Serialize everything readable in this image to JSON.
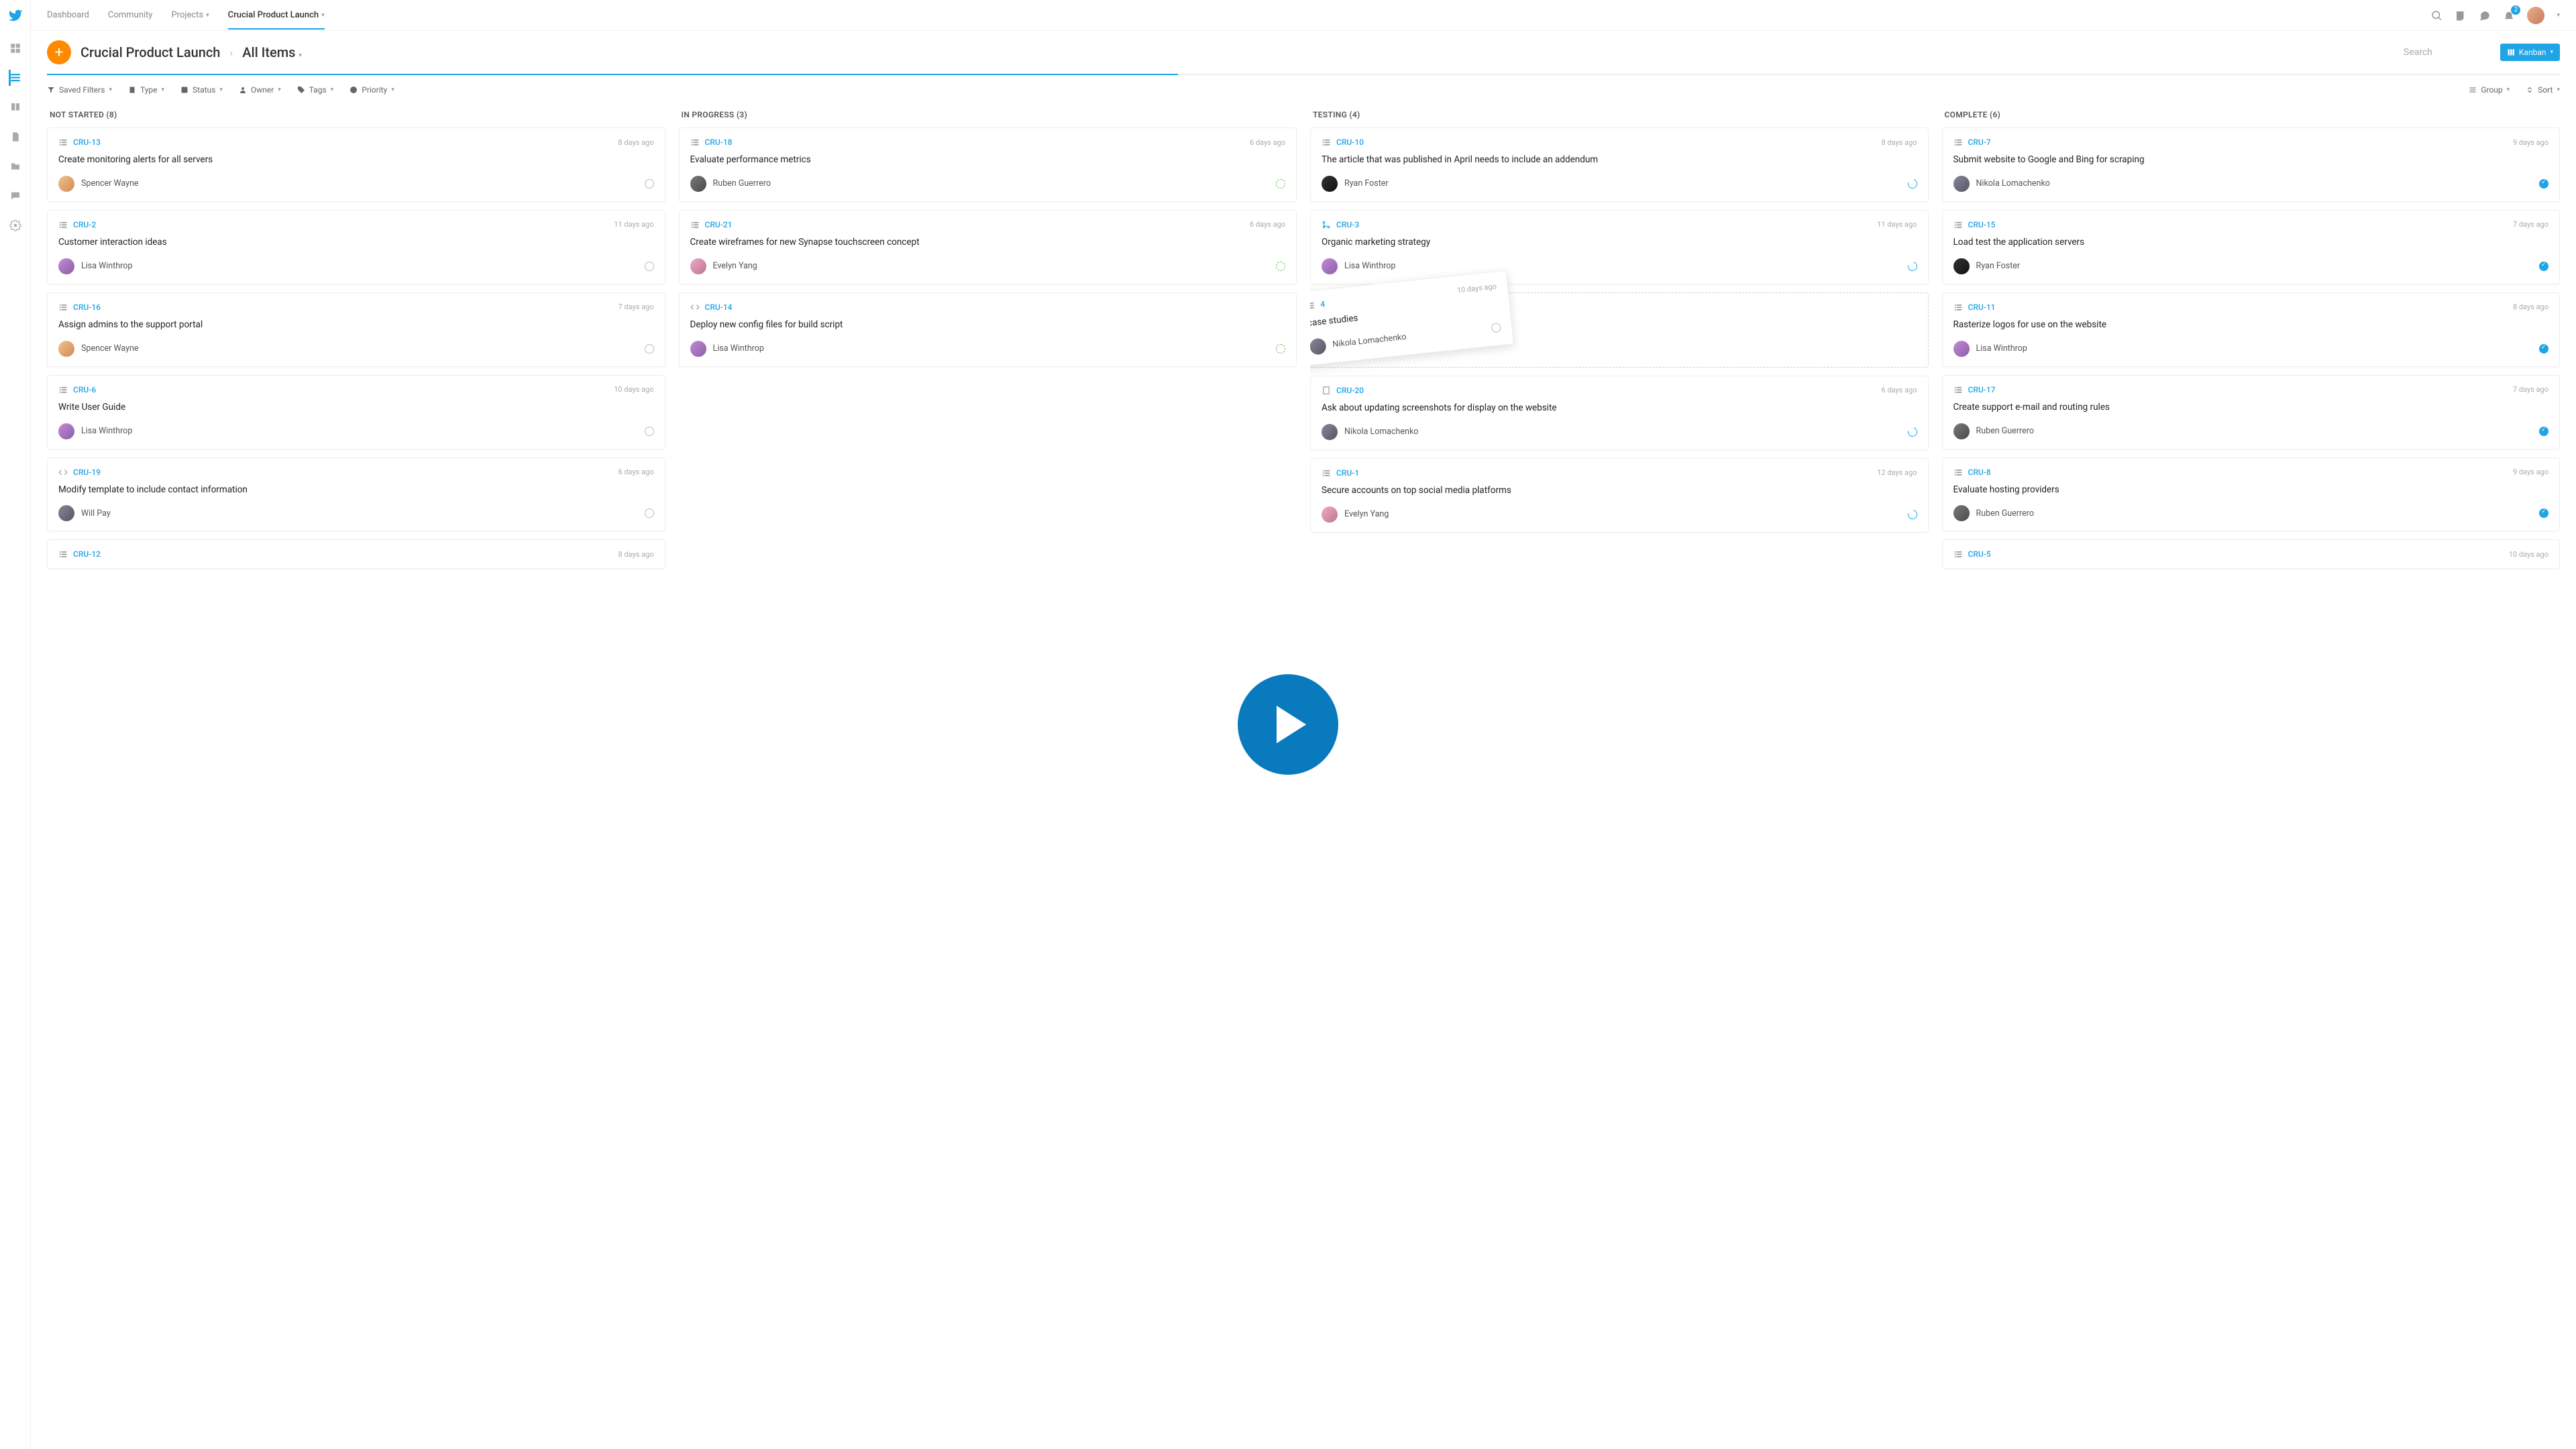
{
  "nav": {
    "items": [
      "Dashboard",
      "Community",
      "Projects",
      "Crucial Product Launch"
    ],
    "active": 3
  },
  "notification_count": "2",
  "breadcrumb": {
    "project": "Crucial Product Launch",
    "scope": "All Items"
  },
  "search_placeholder": "Search",
  "view_button": "Kanban",
  "filters": {
    "saved": "Saved Filters",
    "type": "Type",
    "status": "Status",
    "owner": "Owner",
    "tags": "Tags",
    "priority": "Priority",
    "group": "Group",
    "sort": "Sort"
  },
  "columns": [
    {
      "title": "NOT STARTED (8)",
      "status": "notstarted",
      "cards": [
        {
          "id": "CRU-13",
          "age": "8 days ago",
          "title": "Create monitoring alerts for all servers",
          "assignee": "Spencer Wayne",
          "av": "av1",
          "type": "list"
        },
        {
          "id": "CRU-2",
          "age": "11 days ago",
          "title": "Customer interaction ideas",
          "assignee": "Lisa Winthrop",
          "av": "av2",
          "type": "list"
        },
        {
          "id": "CRU-16",
          "age": "7 days ago",
          "title": "Assign admins to the support portal",
          "assignee": "Spencer Wayne",
          "av": "av1",
          "type": "list"
        },
        {
          "id": "CRU-6",
          "age": "10 days ago",
          "title": "Write User Guide",
          "assignee": "Lisa Winthrop",
          "av": "av2",
          "type": "list"
        },
        {
          "id": "CRU-19",
          "age": "6 days ago",
          "title": "Modify template to include contact information",
          "assignee": "Will Pay",
          "av": "av5",
          "type": "code"
        },
        {
          "id": "CRU-12",
          "age": "8 days ago",
          "title": "",
          "assignee": "",
          "av": "",
          "type": "list"
        }
      ]
    },
    {
      "title": "IN PROGRESS (3)",
      "status": "progress",
      "cards": [
        {
          "id": "CRU-18",
          "age": "6 days ago",
          "title": "Evaluate performance metrics",
          "assignee": "Ruben Guerrero",
          "av": "av3",
          "type": "list"
        },
        {
          "id": "CRU-21",
          "age": "6 days ago",
          "title": "Create wireframes for new Synapse touchscreen concept",
          "assignee": "Evelyn Yang",
          "av": "av6",
          "type": "list"
        },
        {
          "id": "CRU-14",
          "age": "",
          "title": "Deploy new config files for build script",
          "assignee": "Lisa Winthrop",
          "av": "av2",
          "type": "code"
        }
      ]
    },
    {
      "title": "TESTING (4)",
      "status": "testing",
      "cards": [
        {
          "id": "CRU-10",
          "age": "8 days ago",
          "title": "The article that was published in April needs to include an addendum",
          "assignee": "Ryan Foster",
          "av": "av4",
          "type": "list"
        },
        {
          "id": "CRU-3",
          "age": "11 days ago",
          "title": "Organic marketing strategy",
          "assignee": "Lisa Winthrop",
          "av": "av2",
          "type": "merge"
        },
        {
          "id": "DROPZONE",
          "age": "",
          "title": "",
          "assignee": "",
          "av": "",
          "type": ""
        },
        {
          "id": "CRU-20",
          "age": "6 days ago",
          "title": "Ask about updating screenshots for display on the website",
          "assignee": "Nikola Lomachenko",
          "av": "av5",
          "type": "page"
        },
        {
          "id": "CRU-1",
          "age": "12 days ago",
          "title": "Secure accounts on top social media platforms",
          "assignee": "Evelyn Yang",
          "av": "av6",
          "type": "list"
        }
      ]
    },
    {
      "title": "COMPLETE (6)",
      "status": "done",
      "cards": [
        {
          "id": "CRU-7",
          "age": "9 days ago",
          "title": "Submit website to Google and Bing for scraping",
          "assignee": "Nikola Lomachenko",
          "av": "av5",
          "type": "list"
        },
        {
          "id": "CRU-15",
          "age": "7 days ago",
          "title": "Load test the application servers",
          "assignee": "Ryan Foster",
          "av": "av4",
          "type": "list"
        },
        {
          "id": "CRU-11",
          "age": "8 days ago",
          "title": "Rasterize logos for use on the website",
          "assignee": "Lisa Winthrop",
          "av": "av2",
          "type": "list"
        },
        {
          "id": "CRU-17",
          "age": "7 days ago",
          "title": "Create support e-mail and routing rules",
          "assignee": "Ruben Guerrero",
          "av": "av3",
          "type": "list"
        },
        {
          "id": "CRU-8",
          "age": "9 days ago",
          "title": "Evaluate hosting providers",
          "assignee": "Ruben Guerrero",
          "av": "av3",
          "type": "list"
        },
        {
          "id": "CRU-5",
          "age": "10 days ago",
          "title": "",
          "assignee": "",
          "av": "",
          "type": "list"
        }
      ]
    }
  ],
  "ghost": {
    "id": "4",
    "age": "10 days ago",
    "title": "case studies",
    "assignee": "Nikola Lomachenko"
  }
}
